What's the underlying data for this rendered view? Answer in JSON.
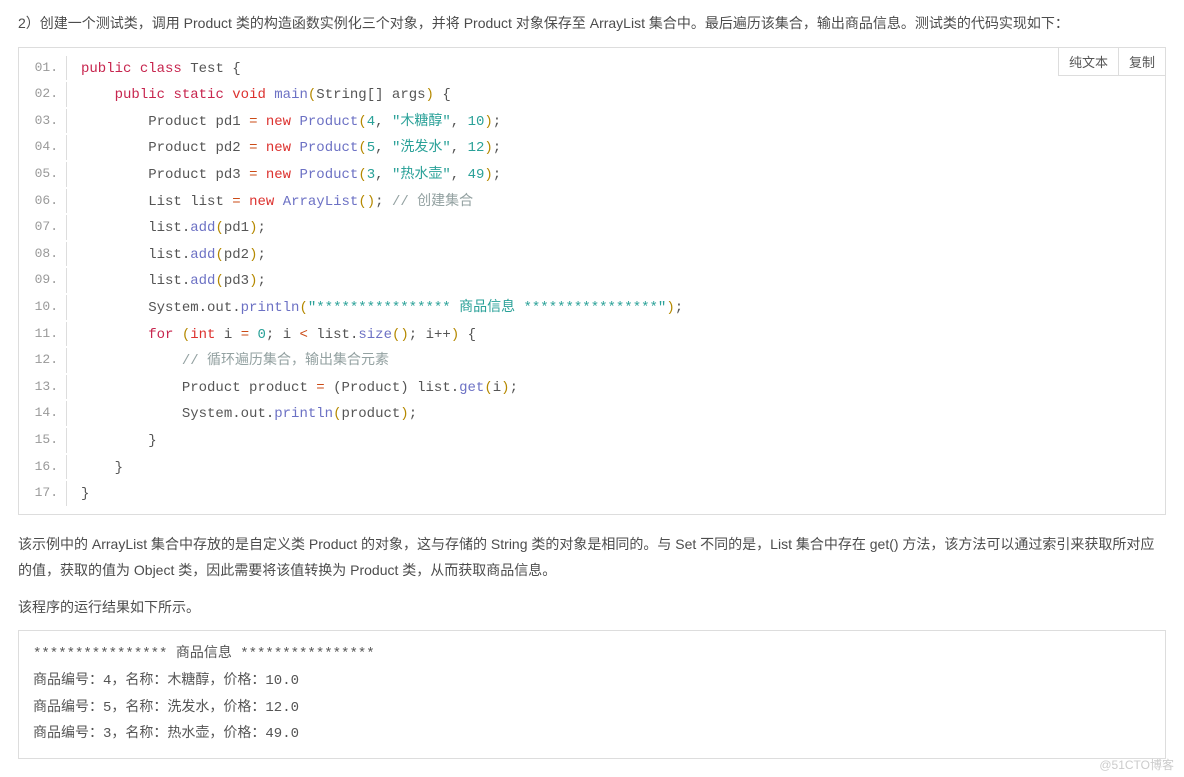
{
  "intro": "2）创建一个测试类，调用 Product 类的构造函数实例化三个对象，并将 Product 对象保存至 ArrayList 集合中。最后遍历该集合，输出商品信息。测试类的代码实现如下：",
  "toolbar": {
    "plain": "纯文本",
    "copy": "复制"
  },
  "lines": {
    "l1": {
      "n": "01."
    },
    "l2": {
      "n": "02."
    },
    "l3": {
      "n": "03."
    },
    "l4": {
      "n": "04."
    },
    "l5": {
      "n": "05."
    },
    "l6": {
      "n": "06."
    },
    "l7": {
      "n": "07."
    },
    "l8": {
      "n": "08."
    },
    "l9": {
      "n": "09."
    },
    "l10": {
      "n": "10."
    },
    "l11": {
      "n": "11."
    },
    "l12": {
      "n": "12."
    },
    "l13": {
      "n": "13."
    },
    "l14": {
      "n": "14."
    },
    "l15": {
      "n": "15."
    },
    "l16": {
      "n": "16."
    },
    "l17": {
      "n": "17."
    }
  },
  "tok": {
    "public": "public",
    "class_kw": "class",
    "Test": "Test",
    "lb": "{",
    "rb": "}",
    "static": "static",
    "void": "void",
    "main": "main",
    "String_arr": "String[]",
    "args": "args",
    "Product": "Product",
    "pd1": "pd1",
    "pd2": "pd2",
    "pd3": "pd3",
    "eq": "=",
    "new": "new",
    "lp": "(",
    "rp": ")",
    "semi": ";",
    "comma": ", ",
    "n4": "4",
    "n5": "5",
    "n3": "3",
    "n10": "10",
    "n12": "12",
    "n49": "49",
    "n0": "0",
    "s_mutang": "\"木糖醇\"",
    "s_xifa": "\"洗发水\"",
    "s_reshui": "\"热水壶\"",
    "List": "List",
    "list": "list",
    "ArrayList": "ArrayList",
    "cmt_create": "// 创建集合",
    "add": "add",
    "System_out": "System.out.",
    "println": "println",
    "s_header": "\"**************** 商品信息 ****************\"",
    "for": "for",
    "int": "int",
    "i": "i",
    "lt": "<",
    "size": "size",
    "ipp": "i++",
    "cmt_loop": "// 循环遍历集合，输出集合元素",
    "product_var": "product",
    "cast_Product": "(Product)",
    "get": "get"
  },
  "para2": "该示例中的 ArrayList 集合中存放的是自定义类 Product 的对象，这与存储的 String 类的对象是相同的。与 Set 不同的是，List 集合中存在 get() 方法，该方法可以通过索引来获取所对应的值，获取的值为 Object 类，因此需要将该值转换为 Product 类，从而获取商品信息。",
  "para3": "该程序的运行结果如下所示。",
  "output": "**************** 商品信息 ****************\n商品编号：4，名称：木糖醇，价格：10.0\n商品编号：5，名称：洗发水，价格：12.0\n商品编号：3，名称：热水壶，价格：49.0",
  "watermark": "@51CTO博客"
}
